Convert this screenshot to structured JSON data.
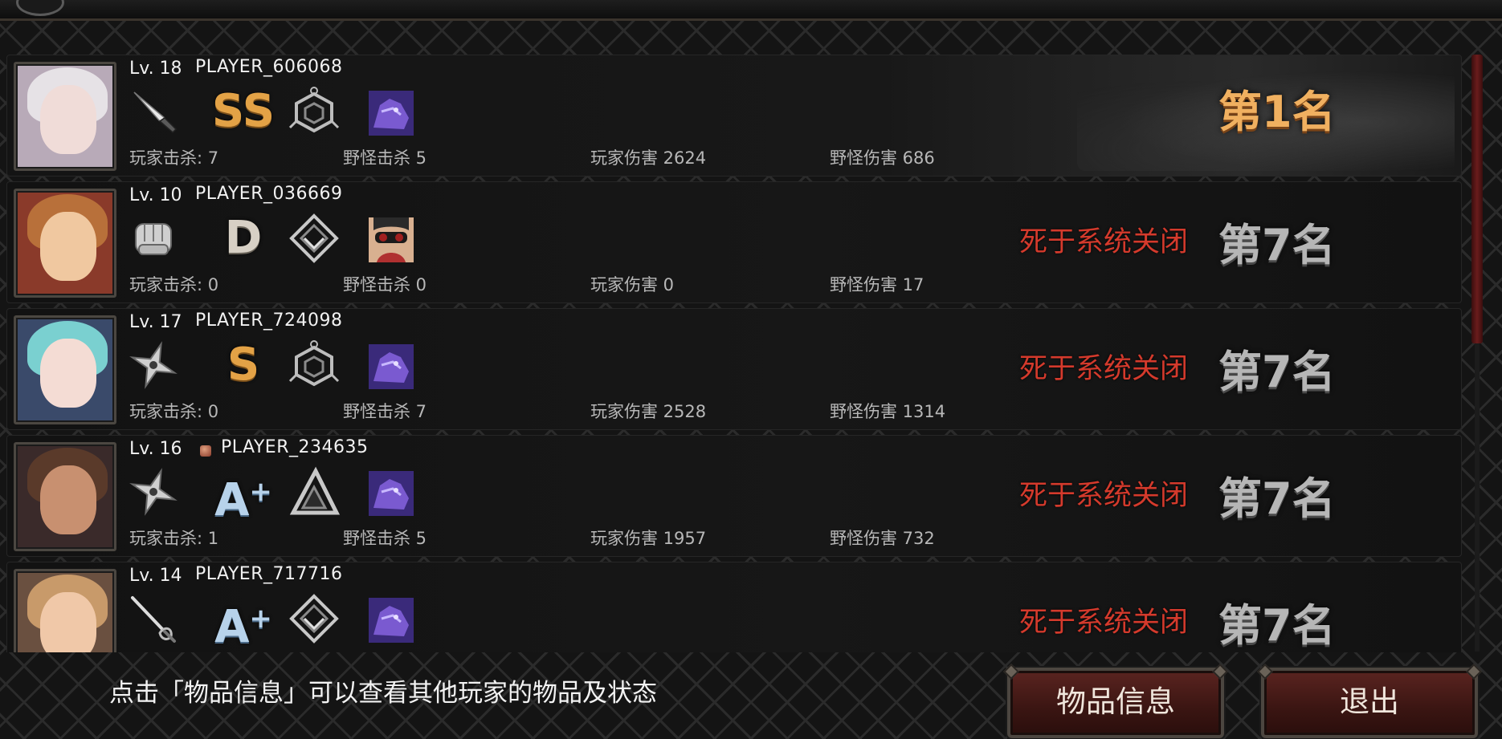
{
  "players": [
    {
      "level": "Lv. 18",
      "name": "PLAYER_606068",
      "weapon_icon": "knife-icon",
      "grade": "SS",
      "grade_color": "#e3a246",
      "emblem_icon": "hexagon-emblem-icon",
      "skill_icon": "purple-beast-icon",
      "kills_player": "玩家击杀: 7",
      "kills_monster": "野怪击杀 5",
      "damage_player": "玩家伤害 2624",
      "damage_monster": "野怪伤害 686",
      "death_text": "",
      "rank": "第1名",
      "avatar_colors": {
        "hair": "#e6e2e6",
        "face": "#f0dcd8",
        "bg": "#b8aab8"
      }
    },
    {
      "level": "Lv. 10",
      "name": "PLAYER_036669",
      "weapon_icon": "fist-icon",
      "grade": "D",
      "grade_color": "#d7d0c5",
      "emblem_icon": "diamond-emblem-icon",
      "skill_icon": "binoculars-man-icon",
      "kills_player": "玩家击杀: 0",
      "kills_monster": "野怪击杀 0",
      "damage_player": "玩家伤害 0",
      "damage_monster": "野怪伤害 17",
      "death_text": "死于系统关闭",
      "rank": "第7名",
      "avatar_colors": {
        "hair": "#b8703a",
        "face": "#f0c8a0",
        "bg": "#8a3a2a"
      }
    },
    {
      "level": "Lv. 17",
      "name": "PLAYER_724098",
      "weapon_icon": "shuriken-icon",
      "grade": "S",
      "grade_color": "#e3a246",
      "emblem_icon": "hexagon-emblem-icon",
      "skill_icon": "purple-beast-icon",
      "kills_player": "玩家击杀: 0",
      "kills_monster": "野怪击杀 7",
      "damage_player": "玩家伤害 2528",
      "damage_monster": "野怪伤害 1314",
      "death_text": "死于系统关闭",
      "rank": "第7名",
      "avatar_colors": {
        "hair": "#7ad0d0",
        "face": "#f4dcd4",
        "bg": "#3a4a6a"
      }
    },
    {
      "level": "Lv. 16",
      "name": "PLAYER_234635",
      "weapon_icon": "shuriken-icon",
      "grade": "A+",
      "grade_color": "#b7d2ea",
      "emblem_icon": "triangle-emblem-icon",
      "skill_icon": "purple-beast-icon",
      "kills_player": "玩家击杀: 1",
      "kills_monster": "野怪击杀 5",
      "damage_player": "玩家伤害 1957",
      "damage_monster": "野怪伤害 732",
      "death_text": "死于系统关闭",
      "rank": "第7名",
      "avatar_colors": {
        "hair": "#5a3a2a",
        "face": "#c89070",
        "bg": "#3a2a2a"
      }
    },
    {
      "level": "Lv. 14",
      "name": "PLAYER_717716",
      "weapon_icon": "rapier-icon",
      "grade": "A+",
      "grade_color": "#b7d2ea",
      "emblem_icon": "diamond-emblem-icon",
      "skill_icon": "purple-beast-icon",
      "kills_player": "",
      "kills_monster": "",
      "damage_player": "",
      "damage_monster": "",
      "death_text": "死于系统关闭",
      "rank": "第7名",
      "avatar_colors": {
        "hair": "#c89a6a",
        "face": "#f0c8a8",
        "bg": "#6a5040"
      }
    }
  ],
  "footer": {
    "hint": "点击「物品信息」可以查看其他玩家的物品及状态",
    "item_info_label": "物品信息",
    "exit_label": "退出"
  },
  "colors": {
    "death_red": "#d43a2c",
    "rank_gold": "#f0b060",
    "rank_silver": "#b6b6b6",
    "button_red": "#5a2420"
  }
}
